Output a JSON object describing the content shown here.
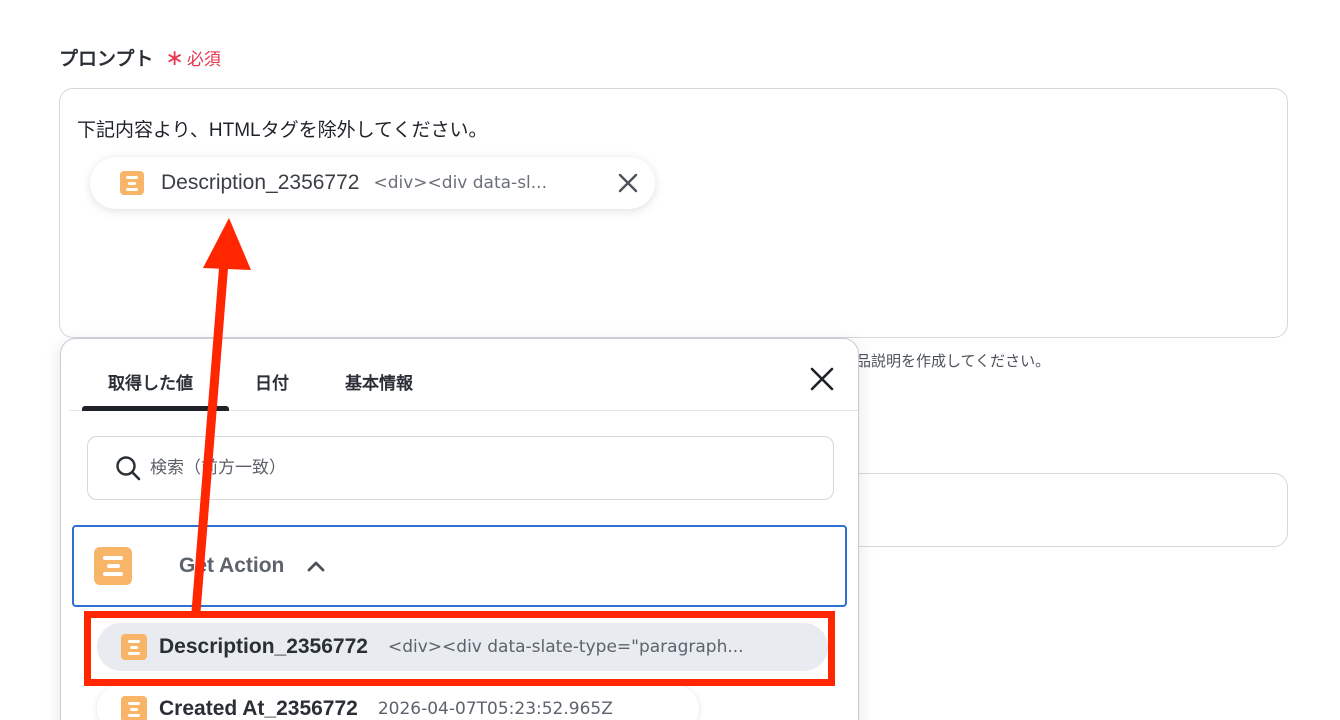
{
  "field": {
    "label": "プロンプト",
    "required_star": "∗",
    "required_text": "必須"
  },
  "prompt": {
    "text": "下記内容より、HTMLタグを除外してください。",
    "chip": {
      "name": "Description_2356772",
      "value": "<div><div data-sl..."
    }
  },
  "hint_text": "品説明を作成してください。",
  "popup": {
    "tabs": [
      "取得した値",
      "日付",
      "基本情報"
    ],
    "active_tab": 0,
    "search_placeholder": "検索（前方一致）",
    "group": {
      "label": "Get Action",
      "expanded": true
    },
    "items": [
      {
        "name": "Description_2356772",
        "value": "<div><div data-slate-type=\"paragraph..."
      },
      {
        "name": "Created At_2356772",
        "value": "2026-04-07T05:23:52.965Z"
      }
    ]
  },
  "colors": {
    "accent_red": "#ff2600",
    "required_red": "#e8384f",
    "app_icon_orange": "#f8b567",
    "focus_blue": "#2f6fd1"
  },
  "icons": {
    "app": "stack-lines-icon",
    "close": "close-icon",
    "search": "search-icon",
    "chevron": "chevron-up-icon"
  }
}
